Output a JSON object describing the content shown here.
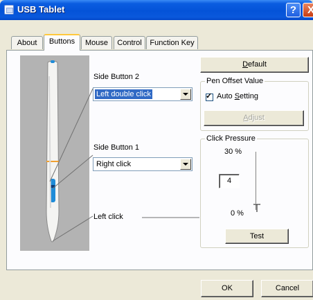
{
  "window": {
    "title": "USB Tablet"
  },
  "title_buttons": {
    "help": "?",
    "close": "X"
  },
  "tabs": [
    {
      "label": "About",
      "active": false
    },
    {
      "label": "Buttons",
      "active": true
    },
    {
      "label": "Mouse",
      "active": false
    },
    {
      "label": "Control",
      "active": false
    },
    {
      "label": "Function Key",
      "active": false
    }
  ],
  "buttons_tab": {
    "side_button_2": {
      "label": "Side Button 2",
      "value": "Left double click"
    },
    "side_button_1": {
      "label": "Side Button 1",
      "value": "Right click"
    },
    "tip": {
      "label": "Left click"
    }
  },
  "default_button": {
    "label": "Default",
    "mnemonic": "D",
    "rest": "efault"
  },
  "pen_offset": {
    "legend": "Pen Offset Value",
    "auto_setting": {
      "label": "Auto Setting",
      "pre": "Auto ",
      "mnemonic": "S",
      "rest": "etting",
      "checked": true,
      "check_glyph": "✓"
    },
    "adjust": {
      "label": "Adjust",
      "mnemonic": "A",
      "rest": "djust",
      "enabled": false
    }
  },
  "click_pressure": {
    "legend": "Click Pressure",
    "max_label": "30 %",
    "min_label": "0 %",
    "value": "4",
    "level_fraction": 0.0,
    "test_label": "Test"
  },
  "dialog_buttons": {
    "ok": "OK",
    "cancel": "Cancel"
  },
  "colors": {
    "title_bar": "#0453d8",
    "face": "#ece9d8",
    "tab_panel": "#fcfcfe",
    "selection": "#316ac5",
    "pen_background": "#b3b3b3",
    "pen_band": "#f0a030",
    "pen_button": "#1f8cd8",
    "active_tab_highlight": "#ffc83c"
  },
  "icons": {
    "app": "tablet-window-icon",
    "help": "help-icon",
    "close": "close-icon",
    "dropdown": "chevron-down-icon"
  }
}
